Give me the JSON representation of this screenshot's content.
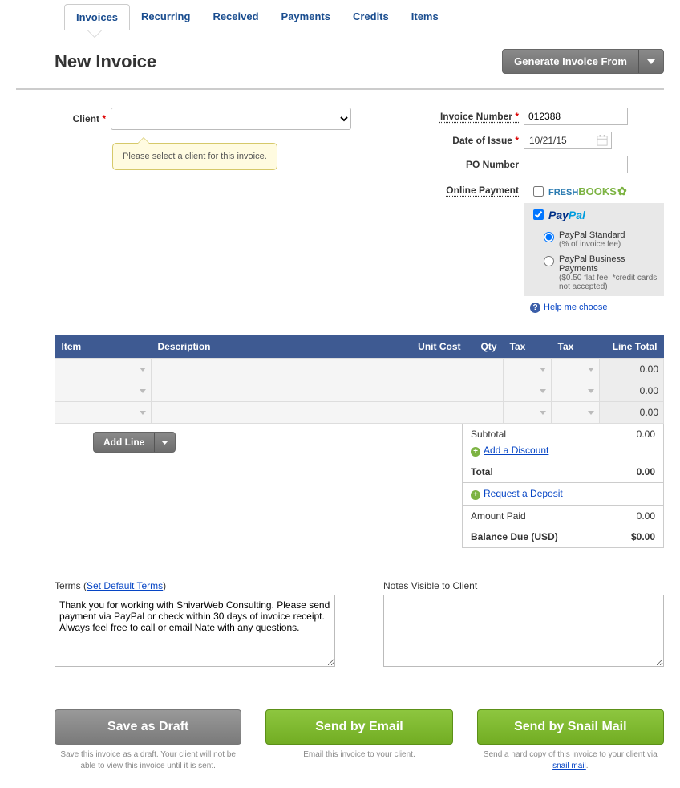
{
  "tabs": [
    "Invoices",
    "Recurring",
    "Received",
    "Payments",
    "Credits",
    "Items"
  ],
  "active_tab": "Invoices",
  "page_title": "New Invoice",
  "generate_btn": "Generate Invoice From",
  "client_label": "Client",
  "tooltip": "Please select a client for this invoice.",
  "right_fields": {
    "invoice_number": {
      "label": "Invoice Number",
      "value": "012388",
      "required": true
    },
    "date_of_issue": {
      "label": "Date of Issue",
      "value": "10/21/15",
      "required": true
    },
    "po_number": {
      "label": "PO Number",
      "value": "",
      "required": false
    },
    "online_payment": {
      "label": "Online Payment"
    }
  },
  "payment_options": {
    "freshbooks": {
      "name": "FreshBooks",
      "checked": false
    },
    "paypal": {
      "name": "PayPal",
      "checked": true,
      "standard": {
        "label": "PayPal Standard",
        "sub": "(% of invoice fee)",
        "selected": true
      },
      "business": {
        "label": "PayPal Business Payments",
        "sub": "($0.50 flat fee, *credit cards not accepted)",
        "selected": false
      }
    },
    "help_link": "Help me choose"
  },
  "table_headers": [
    "Item",
    "Description",
    "Unit Cost",
    "Qty",
    "Tax",
    "Tax",
    "Line Total"
  ],
  "line_items": [
    {
      "total": "0.00"
    },
    {
      "total": "0.00"
    },
    {
      "total": "0.00"
    }
  ],
  "add_line": "Add Line",
  "totals": {
    "subtotal_label": "Subtotal",
    "subtotal": "0.00",
    "discount_link": "Add a Discount",
    "total_label": "Total",
    "total": "0.00",
    "deposit_link": "Request a Deposit",
    "paid_label": "Amount Paid",
    "paid": "0.00",
    "balance_label": "Balance Due (USD)",
    "balance": "$0.00"
  },
  "terms": {
    "label": "Terms (",
    "link": "Set Default Terms",
    "label_end": ")",
    "value": "Thank you for working with ShivarWeb Consulting. Please send payment via PayPal or check within 30 days of invoice receipt. Always feel free to call or email Nate with any questions."
  },
  "notes": {
    "label": "Notes Visible to Client",
    "value": ""
  },
  "actions": {
    "draft": {
      "btn": "Save as Draft",
      "desc": "Save this invoice as a draft. Your client will not be able to view this invoice until it is sent."
    },
    "email": {
      "btn": "Send by Email",
      "desc": "Email this invoice to your client."
    },
    "snail": {
      "btn": "Send by Snail Mail",
      "desc_pre": "Send a hard copy of this invoice to your client via ",
      "desc_link": "snail mail",
      "desc_post": "."
    }
  }
}
